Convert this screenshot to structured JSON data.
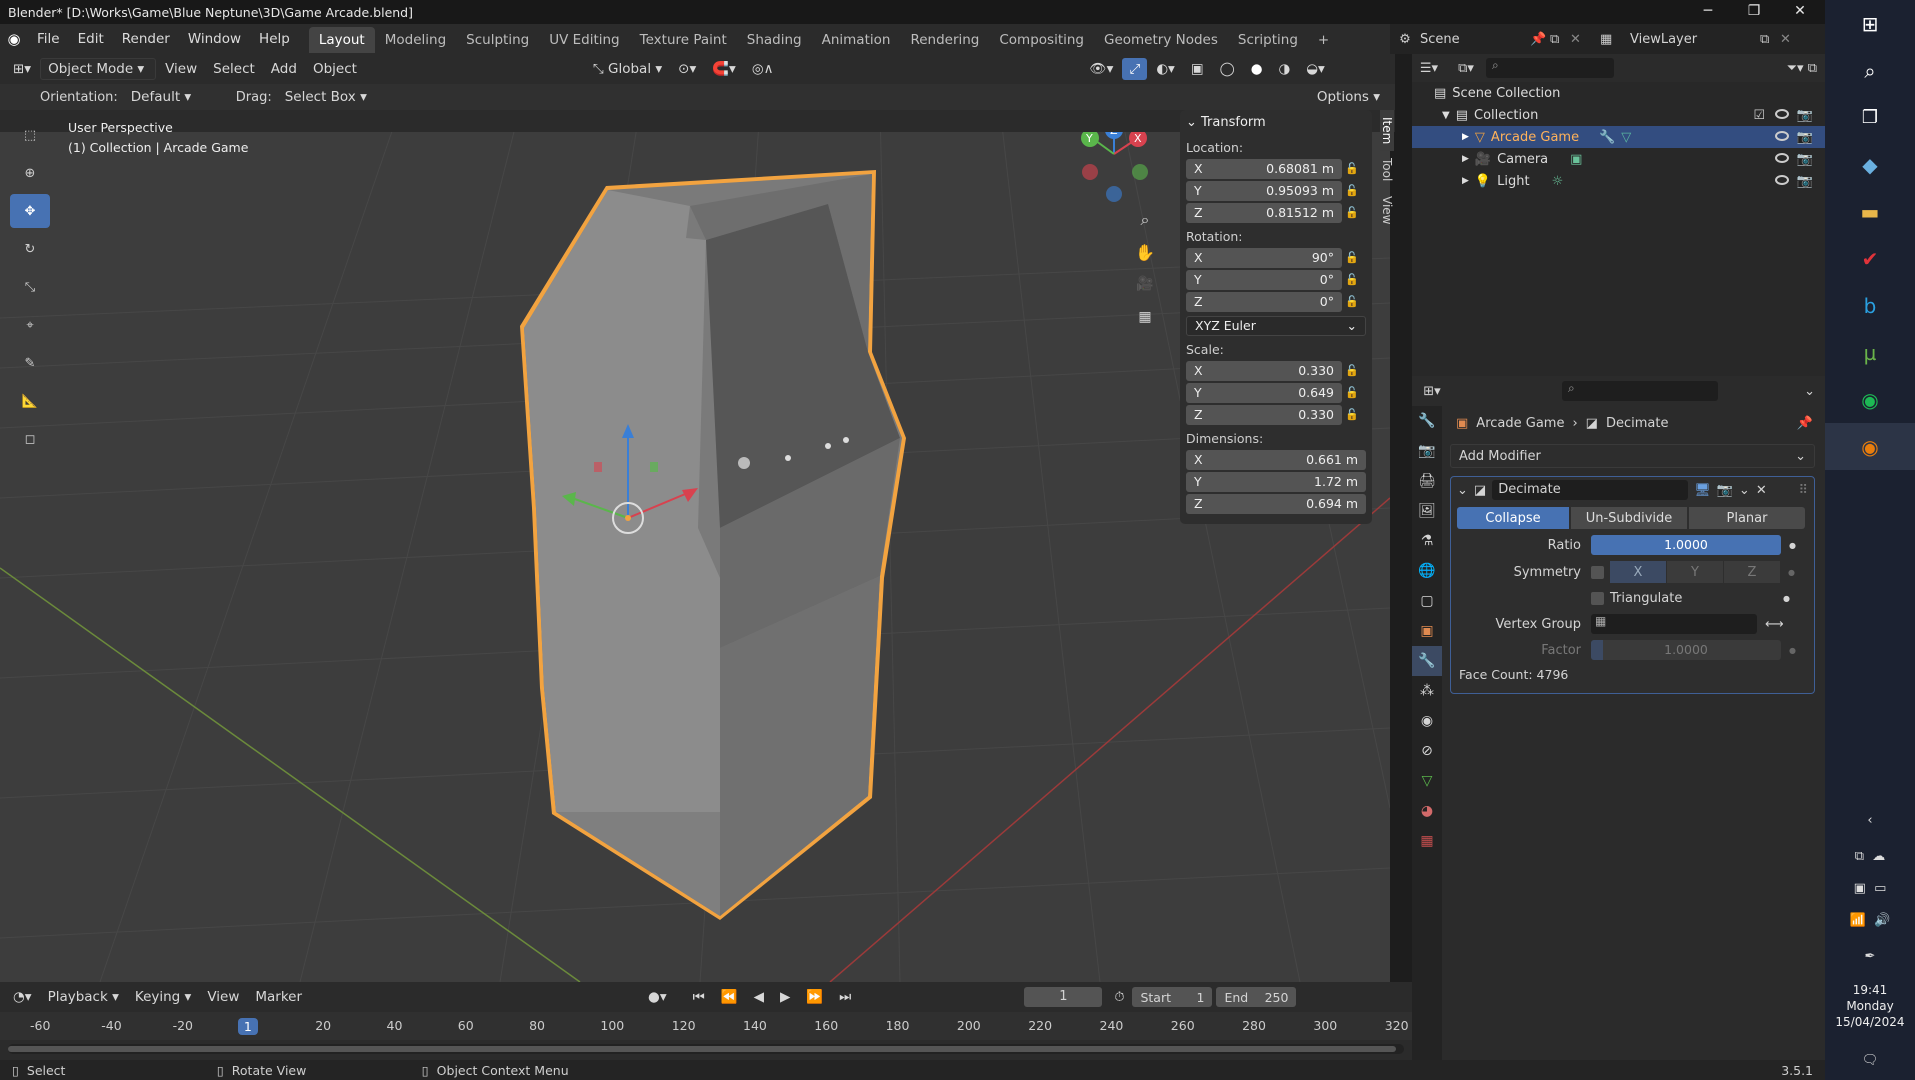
{
  "title": "Blender* [D:\\Works\\Game\\Blue Neptune\\3D\\Game Arcade.blend]",
  "menus": [
    "File",
    "Edit",
    "Render",
    "Window",
    "Help"
  ],
  "workspaces": [
    "Layout",
    "Modeling",
    "Sculpting",
    "UV Editing",
    "Texture Paint",
    "Shading",
    "Animation",
    "Rendering",
    "Compositing",
    "Geometry Nodes",
    "Scripting"
  ],
  "active_workspace": "Layout",
  "scene": {
    "name": "Scene",
    "view_layer": "ViewLayer"
  },
  "viewport_header": {
    "mode": "Object Mode",
    "menus": [
      "View",
      "Select",
      "Add",
      "Object"
    ],
    "transform_orientation": "Global",
    "orientation_label": "Orientation:",
    "orientation_value": "Default",
    "drag_label": "Drag:",
    "drag_value": "Select Box",
    "options": "Options"
  },
  "viewport_info": {
    "perspective": "User Perspective",
    "collection": "(1) Collection | Arcade Game"
  },
  "transform": {
    "title": "Transform",
    "location_label": "Location:",
    "location": [
      {
        "axis": "X",
        "value": "0.68081 m"
      },
      {
        "axis": "Y",
        "value": "0.95093 m"
      },
      {
        "axis": "Z",
        "value": "0.81512 m"
      }
    ],
    "rotation_label": "Rotation:",
    "rotation": [
      {
        "axis": "X",
        "value": "90°"
      },
      {
        "axis": "Y",
        "value": "0°"
      },
      {
        "axis": "Z",
        "value": "0°"
      }
    ],
    "rotation_mode": "XYZ Euler",
    "scale_label": "Scale:",
    "scale": [
      {
        "axis": "X",
        "value": "0.330"
      },
      {
        "axis": "Y",
        "value": "0.649"
      },
      {
        "axis": "Z",
        "value": "0.330"
      }
    ],
    "dimensions_label": "Dimensions:",
    "dimensions": [
      {
        "axis": "X",
        "value": "0.661 m"
      },
      {
        "axis": "Y",
        "value": "1.72 m"
      },
      {
        "axis": "Z",
        "value": "0.694 m"
      }
    ]
  },
  "npanel_tabs": [
    "Item",
    "Tool",
    "View"
  ],
  "outliner": {
    "root": "Scene Collection",
    "collection": "Collection",
    "items": [
      {
        "name": "Arcade Game",
        "selected": true
      },
      {
        "name": "Camera",
        "selected": false
      },
      {
        "name": "Light",
        "selected": false
      }
    ]
  },
  "properties": {
    "breadcrumb_object": "Arcade Game",
    "breadcrumb_modifier": "Decimate",
    "add_modifier": "Add Modifier",
    "modifier_name": "Decimate",
    "modes": [
      "Collapse",
      "Un-Subdivide",
      "Planar"
    ],
    "active_mode": "Collapse",
    "ratio_label": "Ratio",
    "ratio_value": "1.0000",
    "ratio": 1.0,
    "symmetry_label": "Symmetry",
    "symmetry_axes": [
      "X",
      "Y",
      "Z"
    ],
    "triangulate_label": "Triangulate",
    "vertex_group_label": "Vertex Group",
    "factor_label": "Factor",
    "factor_value": "1.0000",
    "face_count": "Face Count: 4796"
  },
  "timeline": {
    "menus": [
      "Playback",
      "Keying",
      "View",
      "Marker"
    ],
    "current_frame": "1",
    "start_label": "Start",
    "start": "1",
    "end_label": "End",
    "end": "250",
    "ticks": [
      "-60",
      "-40",
      "-20",
      "1",
      "20",
      "40",
      "60",
      "80",
      "100",
      "120",
      "140",
      "160",
      "180",
      "200",
      "220",
      "240",
      "260",
      "280",
      "300",
      "320"
    ]
  },
  "statusbar": {
    "select": "Select",
    "rotate": "Rotate View",
    "context": "Object Context Menu",
    "version": "3.5.1"
  },
  "clock": {
    "time": "19:41",
    "day": "Monday",
    "date": "15/04/2024"
  },
  "colors": {
    "accent": "#4772b3",
    "selection_outline": "#f2a340",
    "outliner_selected": "#334d80",
    "background": "#3d3d3d"
  }
}
